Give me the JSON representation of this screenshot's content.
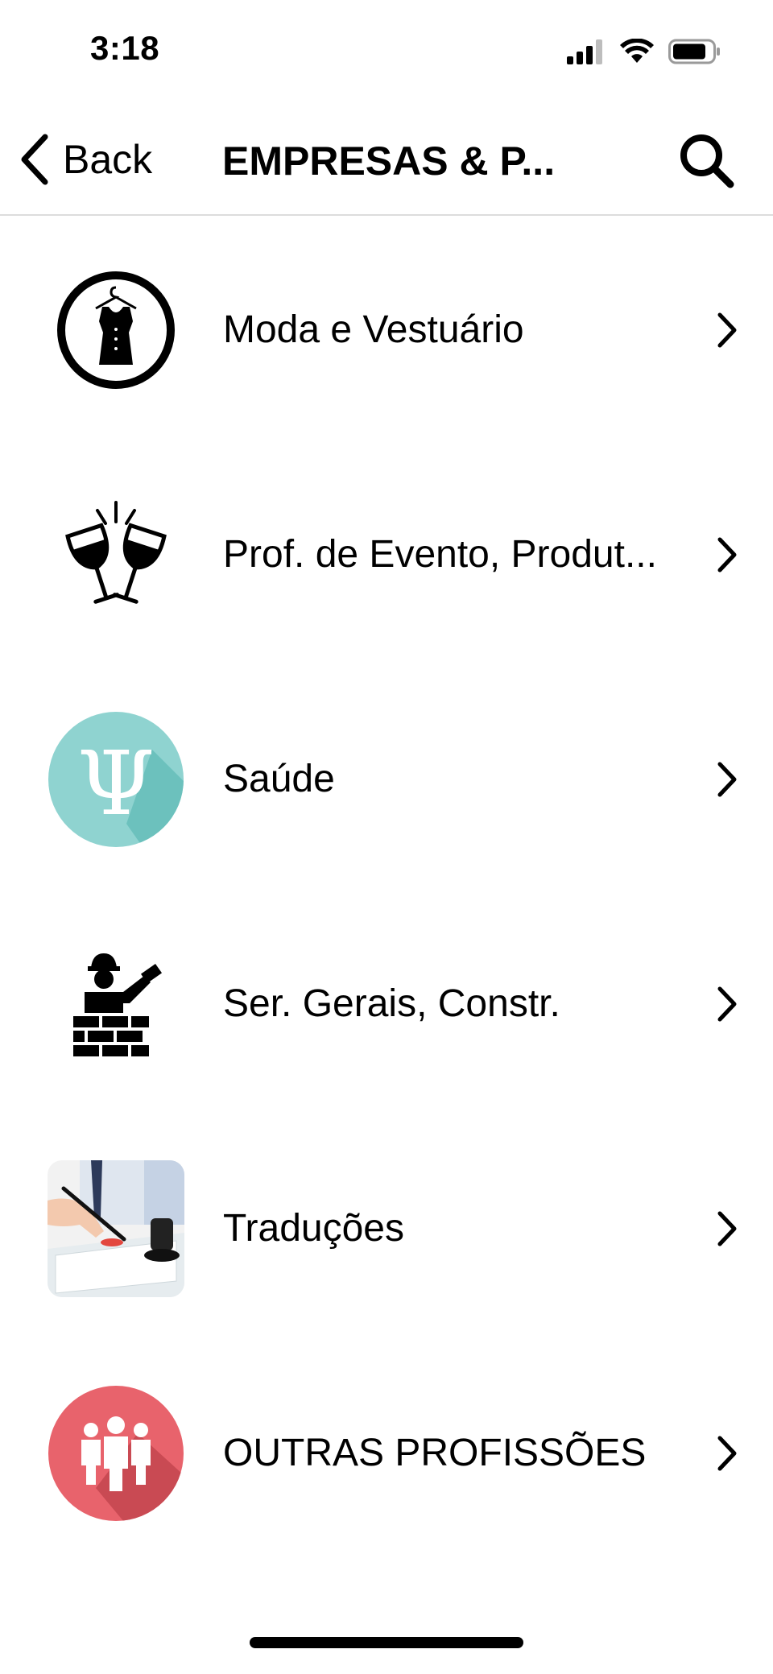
{
  "status_bar": {
    "time": "3:18",
    "icons": [
      "signal-icon",
      "wifi-icon",
      "battery-icon"
    ]
  },
  "nav": {
    "back_label": "Back",
    "title": "EMPRESAS & P...",
    "back_icon": "chevron-left-icon",
    "search_icon": "search-icon"
  },
  "list": {
    "items": [
      {
        "label": "Moda e Vestuário",
        "icon": "dress-hanger-icon"
      },
      {
        "label": "Prof. de Evento, Produt...",
        "icon": "wine-glasses-toast-icon"
      },
      {
        "label": "Saúde",
        "icon": "psi-symbol-icon"
      },
      {
        "label": "Ser. Gerais, Constr.",
        "icon": "construction-worker-icon"
      },
      {
        "label": "Traduções",
        "icon": "signing-document-icon"
      },
      {
        "label": "OUTRAS PROFISSÕES",
        "icon": "people-group-icon"
      }
    ]
  },
  "colors": {
    "saude_circle": "#8fd3d0",
    "outras_circle": "#e8636c",
    "divider": "#dcdcdc"
  }
}
